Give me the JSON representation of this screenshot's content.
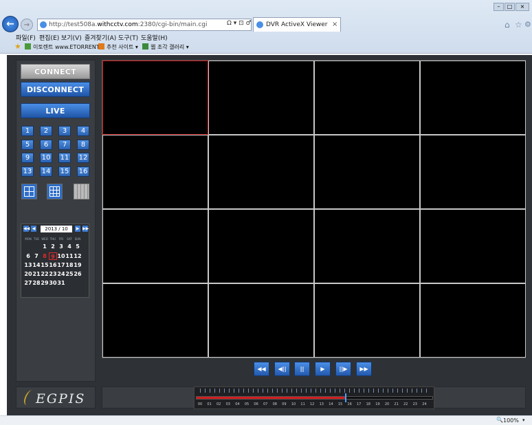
{
  "browser": {
    "url": "http://test508a.withcctv.com:2380/cgi-bin/main.cgi",
    "url_prefix": "http://test508a.",
    "url_domain": "withcctv.com",
    "url_suffix": ":2380/cgi-bin/main.cgi",
    "search_glyph": "Ω ▾ ⊡ ♂",
    "tab_title": "DVR ActiveX Viewer",
    "tab_close": "×",
    "menu": [
      "파일(F)",
      "편집(E)",
      "보기(V)",
      "즐겨찾기(A)",
      "도구(T)",
      "도움말(H)"
    ],
    "favorites": [
      "이토렌트 www.ETORRENT...",
      "추천 사이트 ▾",
      "웹 조각 갤러리 ▾"
    ],
    "zoom": "100%",
    "zoom_arrow": "▾"
  },
  "controls": {
    "connect": "CONNECT",
    "disconnect": "DISCONNECT",
    "live": "LIVE",
    "channels": [
      "1",
      "2",
      "3",
      "4",
      "5",
      "6",
      "7",
      "8",
      "9",
      "10",
      "11",
      "12",
      "13",
      "14",
      "15",
      "16"
    ]
  },
  "calendar": {
    "month": "2013 / 10",
    "nav": [
      "◀◀",
      "◀",
      "▶",
      "▶▶"
    ],
    "weekdays": [
      "MON",
      "TUE",
      "WED",
      "THU",
      "FRI",
      "SAT",
      "SUN"
    ],
    "weeks": [
      [
        "",
        "",
        "1",
        "2",
        "3",
        "4",
        "5"
      ],
      [
        "6",
        "7",
        "8",
        "9",
        "10",
        "11",
        "12"
      ],
      [
        "13",
        "14",
        "15",
        "16",
        "17",
        "18",
        "19"
      ],
      [
        "20",
        "21",
        "22",
        "23",
        "24",
        "25",
        "26"
      ],
      [
        "27",
        "28",
        "29",
        "30",
        "31",
        "",
        ""
      ]
    ],
    "highlighted": [
      "8",
      "9"
    ],
    "selected": "9"
  },
  "playback": [
    "◀◀",
    "◀||",
    "||",
    "▶",
    "||▶",
    "▶▶"
  ],
  "logo": "EGPIS",
  "timeline": {
    "hours": [
      "00",
      "01",
      "02",
      "03",
      "04",
      "05",
      "06",
      "07",
      "08",
      "09",
      "10",
      "11",
      "12",
      "13",
      "14",
      "15",
      "16",
      "17",
      "18",
      "19",
      "20",
      "21",
      "22",
      "23",
      "24"
    ],
    "progress": 0.63,
    "recorded_color": "#d01c1c"
  },
  "colors": {
    "accent": "#2f6fcb",
    "selected_cell": "#d02020"
  }
}
